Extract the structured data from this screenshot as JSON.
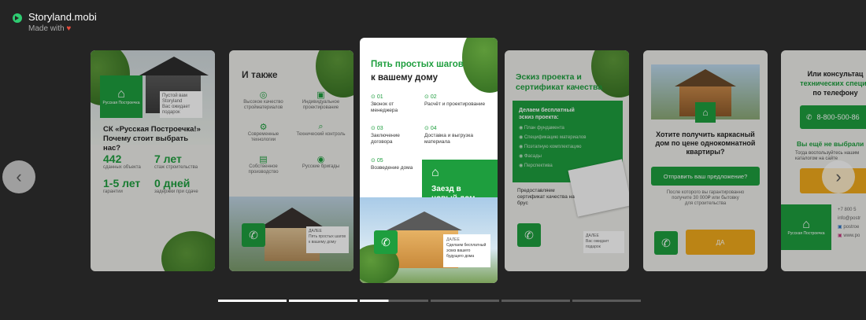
{
  "brand": {
    "title": "Storyland.mobi",
    "made_with": "Made with"
  },
  "card1": {
    "logo_title": "Русская Построечка",
    "badge_line1": "Пустой вам",
    "badge_line2": "Storyland",
    "badge_line3": "Вас ожидает подарок",
    "headline": "СК «Русская Построечка!» Почему стоит выбрать нас?",
    "stats": [
      {
        "value": "442",
        "label": "сданных объекта"
      },
      {
        "value": "7 лет",
        "label": "стаж строительства"
      },
      {
        "value": "1-5 лет",
        "label": "гарантии"
      },
      {
        "value": "0 дней",
        "label": "задержки при сдаче"
      }
    ]
  },
  "card2": {
    "title": "И также",
    "features": [
      "Высокое качество стройматериалов",
      "Индивидуальное проектирование",
      "Современные технологии",
      "Технический контроль",
      "Собственное производство",
      "Русские бригады"
    ],
    "tag_line1": "ДАЛЕЕ",
    "tag_line2": "Пять простых шагов к вашему дому"
  },
  "card3": {
    "title_green": "Пять простых шагов",
    "title_dark": "к вашему дому",
    "steps": [
      {
        "num": "01",
        "text": "Звонок от менеджера"
      },
      {
        "num": "02",
        "text": "Расчёт и проектирование"
      },
      {
        "num": "03",
        "text": "Заключение договора"
      },
      {
        "num": "04",
        "text": "Доставка и выгрузка материала"
      },
      {
        "num": "05",
        "text": "Возведение дома"
      }
    ],
    "final": "Заезд в новый дом",
    "tag_line1": "ДАЛЕЕ",
    "tag_line2": "Сделаем бесплатный эскиз вашего будущего дома"
  },
  "card4": {
    "title": "Эскиз проекта и сертификат качества",
    "box_title": "Делаем бесплатный эскиз проекта:",
    "box_items": [
      "План фундамента",
      "Спецификацию материалов",
      "Поэтапную комплектацию",
      "Фасады",
      "Перспектива"
    ],
    "certificate": "Предоставляем сертификат качества на брус",
    "tag_line1": "ДАЛЕЕ",
    "tag_line2": "Вас ожидает подарок"
  },
  "card5": {
    "question": "Хотите получить каркасный дом по цене однокомнатной квартиры?",
    "button": "Отправить ваш предложение?",
    "note_line1": "После которого вы гарантированно",
    "note_line2": "получите 30 000₽ или бытовку",
    "note_line3": "для строительства",
    "yes_button": "ДА"
  },
  "card6": {
    "title_line1": "Или консультац",
    "title_line2": "технических специа",
    "title_line3": "по телефону",
    "phone": "8-800-500-86",
    "question": "Вы ещё не выбрали п",
    "sub": "Тогда воспользуйтесь нашим каталогом на сайте",
    "contact_phone": "+7 800 5",
    "contact_email": "info@postr",
    "contact_vk": "postroe",
    "contact_insta": "www.po"
  },
  "colors": {
    "accent": "#1e9e3e",
    "background": "#242424",
    "cta": "#f0a91b"
  },
  "icons": {
    "prev": "chevron-left-icon",
    "next": "chevron-right-icon",
    "phone": "phone-icon",
    "home": "home-icon",
    "check": "check-circle-icon"
  },
  "progress": {
    "total_segments": 6,
    "current_segment": 3,
    "current_fill": 0.42
  }
}
